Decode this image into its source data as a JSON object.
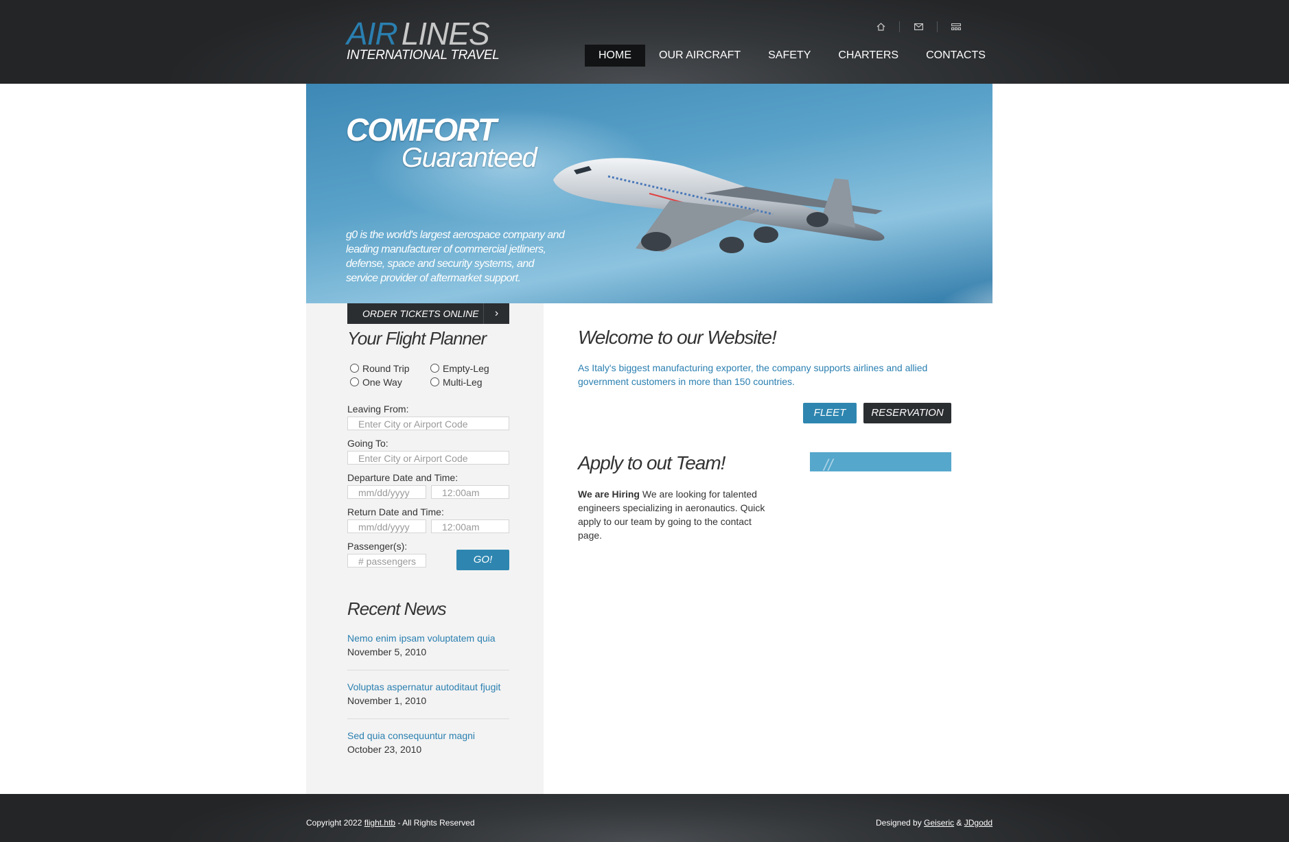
{
  "header": {
    "logo": {
      "air": "AIR",
      "lines": "LINES",
      "sub": "INTERNATIONAL TRAVEL"
    },
    "icons": [
      "home-icon",
      "mail-icon",
      "sitemap-icon"
    ],
    "nav": [
      "HOME",
      "OUR AIRCRAFT",
      "SAFETY",
      "CHARTERS",
      "CONTACTS"
    ],
    "active_nav": "HOME"
  },
  "hero": {
    "title": "COMFORT",
    "subtitle": "Guaranteed",
    "text": "g0 is the world's largest aerospace company and leading manufacturer of commercial jetliners, defense, space and security systems, and service provider of aftermarket support."
  },
  "planner": {
    "order_label": "ORDER TICKETS ONLINE",
    "title": "Your Flight Planner",
    "trip_types": [
      "Round Trip",
      "Empty-Leg",
      "One Way",
      "Multi-Leg"
    ],
    "leaving_label": "Leaving From:",
    "leaving_placeholder": "Enter City or Airport Code",
    "going_label": "Going To:",
    "going_placeholder": "Enter City or Airport Code",
    "departure_label": "Departure Date and Time:",
    "departure_date_placeholder": "mm/dd/yyyy",
    "departure_time_placeholder": "12:00am",
    "return_label": "Return Date and Time:",
    "return_date_placeholder": "mm/dd/yyyy",
    "return_time_placeholder": "12:00am",
    "passengers_label": "Passenger(s):",
    "passengers_placeholder": "# passengers",
    "go_label": "GO!"
  },
  "news": {
    "title": "Recent News",
    "items": [
      {
        "title": "Nemo enim ipsam voluptatem quia",
        "date": "November 5, 2010"
      },
      {
        "title": "Voluptas aspernatur autoditaut fjugit",
        "date": "November 1, 2010"
      },
      {
        "title": "Sed quia consequuntur magni",
        "date": "October 23, 2010"
      }
    ]
  },
  "main": {
    "welcome_title": "Welcome to our Website!",
    "intro": "As Italy's biggest manufacturing exporter, the company supports airlines and allied government customers in more than 150 countries.",
    "fleet_label": "FLEET",
    "reservation_label": "RESERVATION",
    "team_title": "Apply to out Team!",
    "hiring_bold": "We are Hiring",
    "hiring_text": " We are looking for talented engineers specializing in aeronautics. Quick apply to our team by going to the contact page."
  },
  "footer": {
    "copyright_prefix": "Copyright 2022 ",
    "site_link": "flight.htb",
    "copyright_suffix": " - All Rights Reserved",
    "designed_prefix": "Designed by ",
    "designer1": "Geiseric",
    "amp": " & ",
    "designer2": "JDgodd"
  },
  "colors": {
    "accent": "#2a7fb0",
    "dark": "#2b2e31",
    "sidebar": "#f3f3f3"
  }
}
